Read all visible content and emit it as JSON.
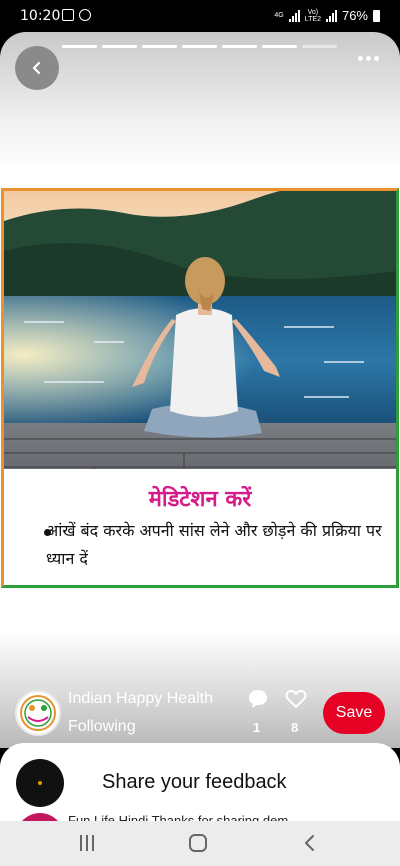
{
  "status_bar": {
    "time": "10:20",
    "network": "4G",
    "volte": "Vo)\nLTE2",
    "battery": "76%"
  },
  "story": {
    "progress_segments": 7,
    "progress_active_fraction": 0.92
  },
  "pin": {
    "caption_title": "मेडिटेशन करें",
    "caption_body": "आंखें बंद करके अपनी सांस लेने और छोड़ने की प्रक्रिया पर ध्यान दें",
    "logo_text": "INDIAN HAPPY HEALTH"
  },
  "creator": {
    "name": "Indian Happy Health",
    "following_label": "Following",
    "comment_count": "1",
    "like_count": "8",
    "save_label": "Save"
  },
  "feedback_sheet": {
    "title": "Share your feedback",
    "peek_text": "Fun Life Hindi  Thanks for sharing dem..."
  },
  "icons": {
    "back": "chevron-left-icon",
    "more": "more-horizontal-icon",
    "comment": "speech-bubble-icon",
    "like": "heart-icon"
  },
  "colors": {
    "save_button": "#e60023",
    "caption_title": "#d81b8a",
    "frame_orange": "#e8912d",
    "frame_green": "#2e9e3a"
  }
}
